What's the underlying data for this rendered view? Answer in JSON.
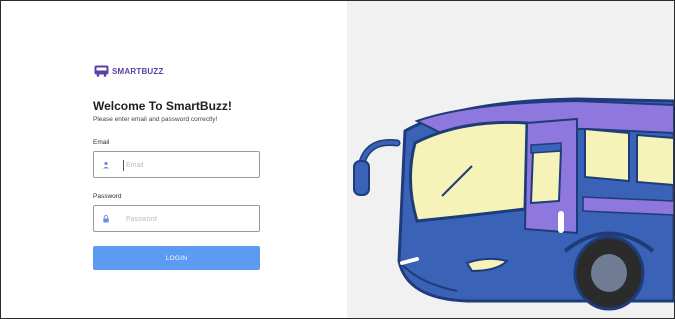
{
  "brand": {
    "name": "SMARTBUZZ",
    "color": "#5b3fa6"
  },
  "form": {
    "heading": "Welcome To SmartBuzz!",
    "subheading": "Please enter email and password correctly!",
    "email": {
      "label": "Email",
      "placeholder": "Email",
      "value": "",
      "icon": "person-icon"
    },
    "password": {
      "label": "Password",
      "placeholder": "Password",
      "value": "",
      "icon": "lock-icon"
    },
    "login_label": "LOGIN",
    "login_color": "#5b9cf2"
  },
  "illustration": {
    "subject": "bus-illustration",
    "body_color": "#3a63b7",
    "roof_color": "#8f78dd"
  }
}
